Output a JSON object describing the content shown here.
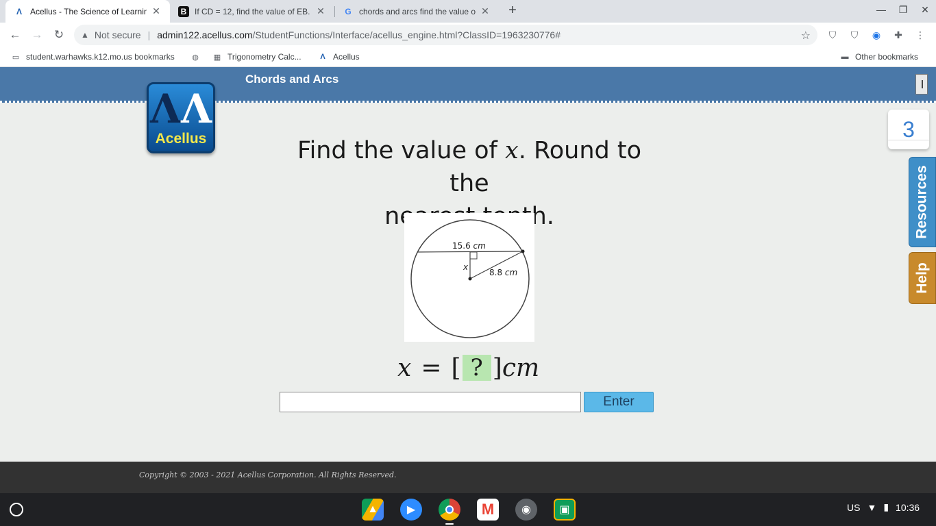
{
  "browser": {
    "tabs": [
      {
        "title": "Acellus - The Science of Learning",
        "favicon": "acellus-icon"
      },
      {
        "title": "If CD = 12, find the value of EB. -",
        "favicon": "brainly-icon"
      },
      {
        "title": "chords and arcs find the value of",
        "favicon": "google-icon"
      }
    ],
    "new_tab_label": "+",
    "address": {
      "security_label": "Not secure",
      "host": "admin122.acellus.com",
      "path": "/StudentFunctions/Interface/acellus_engine.html?ClassID=1963230776#"
    },
    "bookmarks": [
      {
        "label": "student.warhawks.k12.mo.us bookmarks",
        "icon": "folder-icon"
      },
      {
        "label": "",
        "icon": "globe-icon"
      },
      {
        "label": "Trigonometry Calc...",
        "icon": "calculator-icon"
      },
      {
        "label": "Acellus",
        "icon": "acellus-icon"
      }
    ],
    "other_bookmarks": "Other bookmarks"
  },
  "app": {
    "course_title": "Chords and Arcs",
    "logo_text": "Acellus",
    "counter": "3",
    "side_tabs": {
      "resources": "Resources",
      "help": "Help"
    }
  },
  "question": {
    "line1_prefix": "Find the value of ",
    "variable": "x",
    "line1_suffix": ".  Round to the",
    "line2": "nearest tenth."
  },
  "figure": {
    "chord_label_value": "15.6",
    "chord_label_unit": "cm",
    "radius_label_value": "8.8",
    "radius_label_unit": "cm",
    "distance_label": "x"
  },
  "equation": {
    "variable": "x",
    "equals": "=",
    "open_bracket": "[",
    "placeholder": "?",
    "close_bracket": "]",
    "unit": "cm"
  },
  "answer": {
    "value": "",
    "enter_label": "Enter"
  },
  "footer": {
    "copyright": "Copyright © 2003 - 2021 Acellus Corporation.  All Rights Reserved."
  },
  "system": {
    "locale": "US",
    "time": "10:36"
  },
  "colors": {
    "header_blue": "#4a78a8",
    "resources_tab": "#3f8fc8",
    "help_tab": "#c88a2c",
    "enter_button": "#5bb8e8",
    "placeholder_green": "#b8e6b0"
  }
}
